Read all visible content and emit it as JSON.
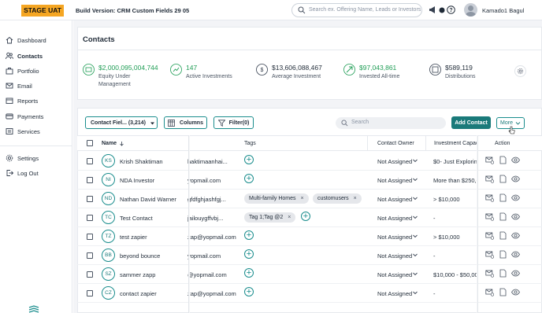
{
  "topbar": {
    "env_badge": "STAGE UAT",
    "build_version": "Build Version: CRM Custom Fields 29 05",
    "search_placeholder": "Search ex. Offering Name, Leads or Investors",
    "user_name": "Kamado1 Bagul"
  },
  "sidebar": {
    "items": [
      {
        "label": "Dashboard",
        "icon": "home-icon"
      },
      {
        "label": "Contacts",
        "icon": "users-icon",
        "active": true
      },
      {
        "label": "Portfolio",
        "icon": "briefcase-icon"
      },
      {
        "label": "Email",
        "icon": "mail-icon"
      },
      {
        "label": "Reports",
        "icon": "reports-icon"
      },
      {
        "label": "Payments",
        "icon": "credit-card-icon"
      },
      {
        "label": "Services",
        "icon": "services-icon"
      }
    ],
    "bottom_items": [
      {
        "label": "Settings",
        "icon": "gear-icon"
      },
      {
        "label": "Log Out",
        "icon": "logout-icon"
      }
    ]
  },
  "page": {
    "title": "Contacts"
  },
  "metrics": [
    {
      "value": "$2,000,095,004,744",
      "label": "Equity Under Management",
      "color": "#1f9d55"
    },
    {
      "value": "147",
      "label": "Active Investments",
      "color": "#1f9d55"
    },
    {
      "value": "$13,606,088,467",
      "label": "Average Investment",
      "color": "#1f2a37"
    },
    {
      "value": "$97,043,861",
      "label": "Invested All-time",
      "color": "#1f9d55"
    },
    {
      "value": "$589,119",
      "label": "Distributions",
      "color": "#1f2a37"
    }
  ],
  "toolbar": {
    "contact_fields": "Contact Fiel... (3,214)",
    "columns": "Columns",
    "filter": "Filter(0)",
    "search_placeholder": "Search",
    "add_contact": "Add Contact",
    "more": "More"
  },
  "table": {
    "headers": {
      "name": "Name",
      "tags": "Tags",
      "owner": "Contact Owner",
      "investment": "Investment Capaci",
      "action": "Action"
    },
    "rows": [
      {
        "initials": "KS",
        "name": "Krish Shaktiman",
        "email": "haktimaanhai...",
        "tags": [],
        "owner": "Not Assigned",
        "investment": "$0- Just Exploring"
      },
      {
        "initials": "NI",
        "name": "NDA Investor",
        "email": "yopmail.com",
        "tags": [],
        "owner": "Not Assigned",
        "investment": "More than $250,0"
      },
      {
        "initials": "ND",
        "name": "Nathan David Warner",
        "email": "gfdfghjashfgj...",
        "tags": [
          "Multi-family Homes",
          "customusers"
        ],
        "owner": "Not Assigned",
        "investment": "> $10,000"
      },
      {
        "initials": "TC",
        "name": "Test Contact",
        "email": "jailouygffvbj...",
        "tags": [
          "Tag 1;Tag @2"
        ],
        "owner": "Not Assigned",
        "investment": "-"
      },
      {
        "initials": "TZ",
        "name": "test zapier",
        "email": "zap@yopmail.com",
        "tags": [],
        "owner": "Not Assigned",
        "investment": "> $10,000"
      },
      {
        "initials": "BB",
        "name": "beyond bounce",
        "email": "yopmail.com",
        "tags": [],
        "owner": "Not Assigned",
        "investment": "-"
      },
      {
        "initials": "SZ",
        "name": "sammer zapp",
        "email": "@yopmail.com",
        "tags": [],
        "owner": "Not Assigned",
        "investment": "$10,000 - $50,000"
      },
      {
        "initials": "CZ",
        "name": "contact zapier",
        "email": "zap@yopmail.com",
        "tags": [],
        "owner": "Not Assigned",
        "investment": "-"
      }
    ]
  },
  "colors": {
    "accent": "#1a7a7a",
    "badge": "#f5a623",
    "positive": "#1f9d55"
  }
}
